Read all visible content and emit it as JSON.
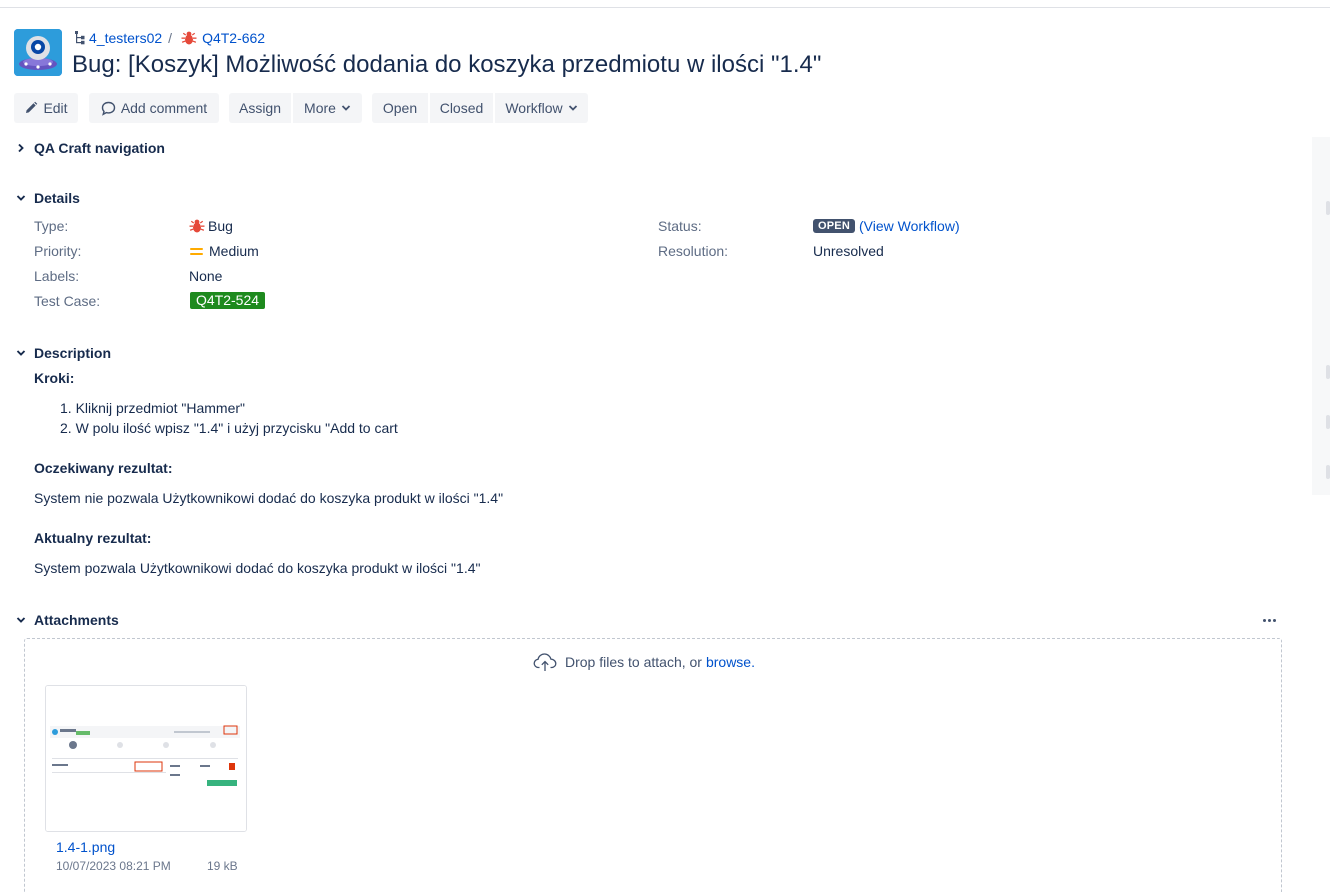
{
  "breadcrumb": {
    "project": "4_testers02",
    "separator": "/",
    "issue_key": "Q4T2-662"
  },
  "issue": {
    "title": "Bug:  [Koszyk] Możliwość dodania do koszyka przedmiotu w ilości \"1.4\""
  },
  "toolbar": {
    "edit": "Edit",
    "add_comment": "Add comment",
    "assign": "Assign",
    "more": "More",
    "open": "Open",
    "closed": "Closed",
    "workflow": "Workflow"
  },
  "sections": {
    "qa_nav": "QA Craft navigation",
    "details": "Details",
    "description": "Description",
    "attachments": "Attachments"
  },
  "details": {
    "type_label": "Type:",
    "type_value": "Bug",
    "priority_label": "Priority:",
    "priority_value": "Medium",
    "labels_label": "Labels:",
    "labels_value": "None",
    "testcase_label": "Test Case:",
    "testcase_value": "Q4T2-524",
    "status_label": "Status:",
    "status_value": "OPEN",
    "view_workflow_open": "(",
    "view_workflow": "View Workflow",
    "view_workflow_close": ")",
    "resolution_label": "Resolution:",
    "resolution_value": "Unresolved"
  },
  "description": {
    "steps_heading": "Kroki:",
    "step1": "1. Kliknij przedmiot \"Hammer\"",
    "step2": "2. W polu ilość wpisz \"1.4\" i użyj przycisku \"Add to cart",
    "expected_heading": "Oczekiwany rezultat:",
    "expected_text": "System nie pozwala Użytkownikowi dodać do koszyka produkt w ilości \"1.4\"",
    "actual_heading": "Aktualny rezultat:",
    "actual_text": "System pozwala Użytkownikowi dodać do koszyka produkt w ilości \"1.4\""
  },
  "attachments": {
    "drop_text": "Drop files to attach, or",
    "browse": "browse.",
    "file_name": "1.4-1.png",
    "file_date": "10/07/2023 08:21 PM",
    "file_size": "19 kB"
  },
  "colors": {
    "link": "#0052cc",
    "bug_red": "#e5493a",
    "priority_orange": "#ffab00",
    "status_lozenge": "#42526e",
    "testcase_green": "#1e8a1e"
  }
}
